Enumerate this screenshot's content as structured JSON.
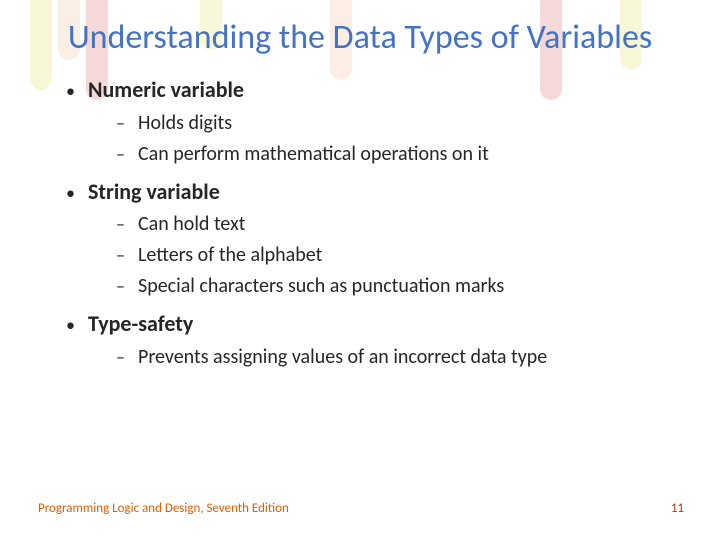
{
  "title": "Understanding the Data Types of Variables",
  "bullets": [
    {
      "label": "Numeric variable",
      "sub": [
        "Holds digits",
        "Can perform mathematical operations on it"
      ]
    },
    {
      "label": "String variable",
      "sub": [
        "Can hold text",
        "Letters of the alphabet",
        "Special characters such as punctuation marks"
      ]
    },
    {
      "label": "Type-safety",
      "sub": [
        "Prevents assigning values of an incorrect data type"
      ]
    }
  ],
  "footer": {
    "left": "Programming Logic and Design, Seventh Edition",
    "right": "11"
  }
}
